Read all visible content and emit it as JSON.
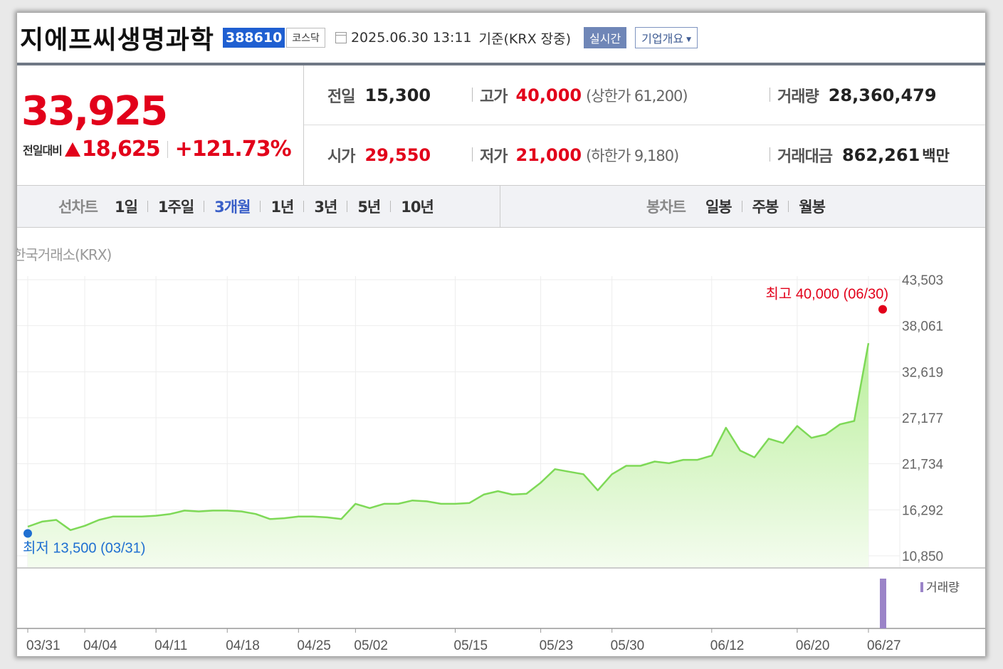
{
  "header": {
    "company_name": "지에프씨생명과학",
    "stock_code": "388610",
    "market": "코스닥",
    "datetime": "2025.06.30 13:11",
    "basis": "기준(KRX 장중)",
    "realtime_label": "실시간",
    "company_info_label": "기업개요"
  },
  "price": {
    "current": "33,925",
    "change_label": "전일대비",
    "change_value": "18,625",
    "change_pct": "+121.73%"
  },
  "stats": {
    "prev_close_label": "전일",
    "prev_close": "15,300",
    "high_label": "고가",
    "high": "40,000",
    "upper_limit_text": "(상한가 61,200)",
    "volume_label": "거래량",
    "volume": "28,360,479",
    "open_label": "시가",
    "open": "29,550",
    "low_label": "저가",
    "low": "21,000",
    "lower_limit_text": "(하한가 9,180)",
    "amount_label": "거래대금",
    "amount": "862,261",
    "amount_unit": "백만"
  },
  "tabs": {
    "line_label": "선차트",
    "line_items": [
      "1일",
      "1주일",
      "3개월",
      "1년",
      "3년",
      "5년",
      "10년"
    ],
    "active": "3개월",
    "candle_label": "봉차트",
    "candle_items": [
      "일봉",
      "주봉",
      "월봉"
    ]
  },
  "exchange_label": "한국거래소(KRX)",
  "colors": {
    "up": "#e2001a",
    "accent": "#3a5fc8",
    "line": "#7ed957",
    "volume": "#9b84c8",
    "low_marker": "#1f6fd1"
  },
  "chart_data": {
    "type": "area",
    "y_ticks": [
      43503,
      38061,
      32619,
      27177,
      21734,
      16292,
      10850
    ],
    "y_tick_labels": [
      "43,503",
      "38,061",
      "32,619",
      "27,177",
      "21,734",
      "16,292",
      "10,850"
    ],
    "ylim": [
      10850,
      43503
    ],
    "x_tick_labels": [
      "03/31",
      "04/04",
      "04/11",
      "04/18",
      "04/25",
      "05/02",
      "05/15",
      "05/23",
      "05/30",
      "06/12",
      "06/20",
      "06/27"
    ],
    "x_tick_index": [
      0,
      4,
      9,
      14,
      19,
      23,
      30,
      36,
      41,
      48,
      54,
      59
    ],
    "values": [
      14300,
      14900,
      15100,
      13900,
      14400,
      15100,
      15500,
      15500,
      15500,
      15600,
      15800,
      16200,
      16100,
      16200,
      16200,
      16100,
      15800,
      15200,
      15300,
      15500,
      15500,
      15400,
      15200,
      17000,
      16500,
      17000,
      17000,
      17400,
      17300,
      17000,
      17000,
      17100,
      18100,
      18500,
      18100,
      18200,
      19500,
      21100,
      20800,
      20500,
      18600,
      20500,
      21500,
      21500,
      22000,
      21800,
      22200,
      22200,
      22700,
      26000,
      23300,
      22500,
      24700,
      24200,
      26200,
      24800,
      25200,
      26400,
      26800,
      36000
    ],
    "high_annotation": "최고 40,000 (06/30)",
    "high_value": 40000,
    "low_annotation": "최저 13,500 (03/31)",
    "low_value": 13500,
    "volume_legend": "거래량",
    "volume_bar_index": 60
  }
}
